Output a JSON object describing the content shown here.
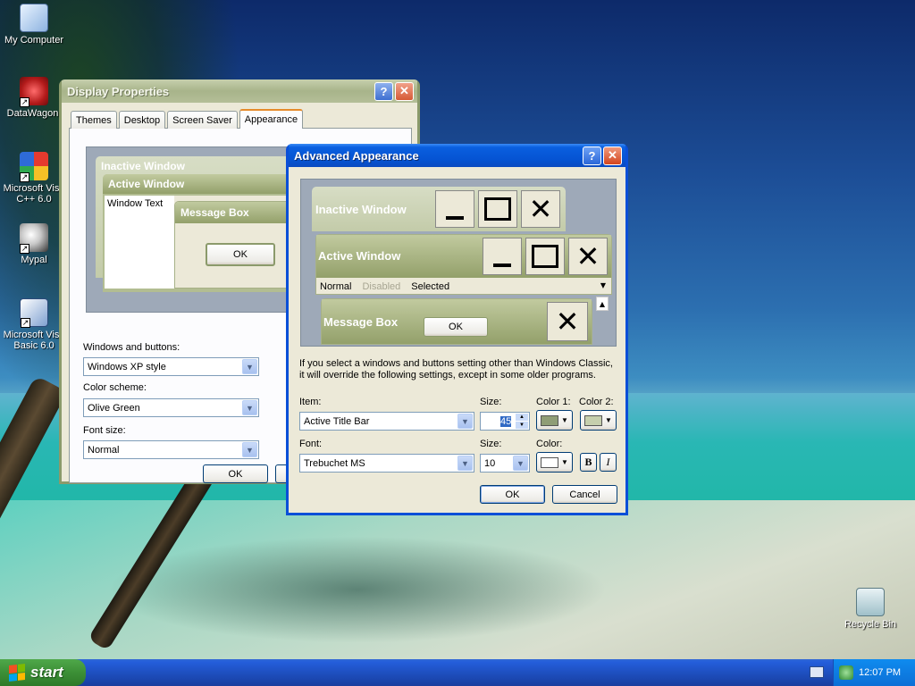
{
  "desktop": {
    "icons": [
      {
        "label": "My Computer"
      },
      {
        "label": "DataWagon."
      },
      {
        "label": "Microsoft Visu C++ 6.0"
      },
      {
        "label": "Mypal"
      },
      {
        "label": "Microsoft Visu Basic 6.0"
      },
      {
        "label": "Recycle Bin"
      }
    ]
  },
  "display_properties": {
    "title": "Display Properties",
    "help_glyph": "?",
    "close_glyph": "✕",
    "tabs": [
      "Themes",
      "Desktop",
      "Screen Saver",
      "Appearance"
    ],
    "preview": {
      "inactive_title": "Inactive Window",
      "active_title": "Active Window",
      "window_text": "Window Text",
      "message_box_title": "Message Box",
      "ok": "OK"
    },
    "windows_buttons_label": "Windows and buttons:",
    "windows_buttons_value": "Windows XP style",
    "color_scheme_label": "Color scheme:",
    "color_scheme_value": "Olive Green",
    "font_size_label": "Font size:",
    "font_size_value": "Normal",
    "ok_button": "OK"
  },
  "advanced_appearance": {
    "title": "Advanced Appearance",
    "help_glyph": "?",
    "close_glyph": "✕",
    "preview": {
      "inactive_title": "Inactive Window",
      "active_title": "Active Window",
      "menu_normal": "Normal",
      "menu_disabled": "Disabled",
      "menu_selected": "Selected",
      "message_box_title": "Message Box",
      "ok": "OK"
    },
    "info_text_line1": "If you select a windows and buttons setting other than Windows Classic,",
    "info_text_line2": "it will override the following settings, except in some older programs.",
    "item_label": "Item:",
    "item_value": "Active Title Bar",
    "item_size_label": "Size:",
    "item_size_value": "45",
    "color1_label": "Color 1:",
    "color2_label": "Color 2:",
    "font_label": "Font:",
    "font_value": "Trebuchet MS",
    "font_size_label": "Size:",
    "font_size_value": "10",
    "font_color_label": "Color:",
    "bold_glyph": "B",
    "italic_glyph": "I",
    "ok_button": "OK",
    "cancel_button": "Cancel",
    "colors": {
      "color1": "#8f9d76",
      "color2": "#c6cfad",
      "font_color": "#ffffff"
    }
  },
  "taskbar": {
    "start_label": "start",
    "clock": "12:07 PM"
  }
}
